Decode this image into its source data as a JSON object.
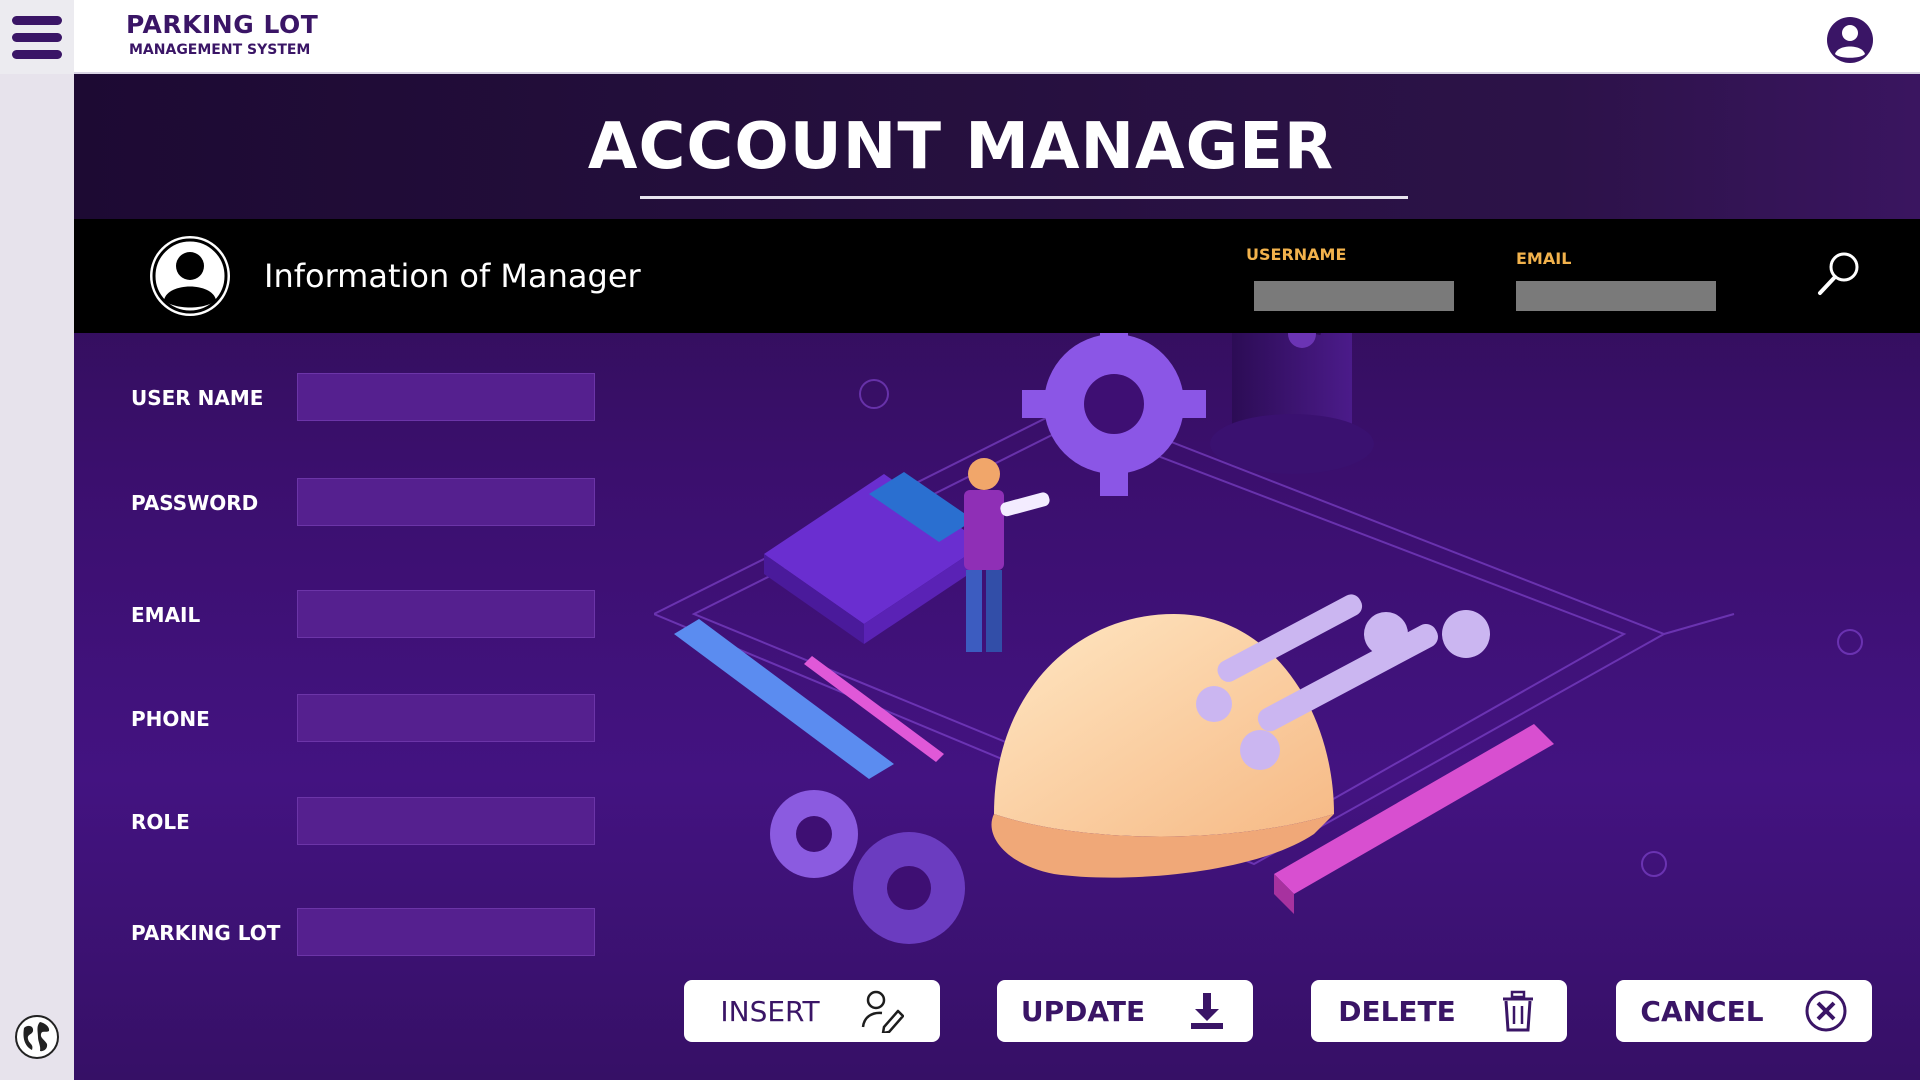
{
  "app": {
    "brand_title": "PARKING LOT",
    "brand_subtitle": "MANAGEMENT SYSTEM"
  },
  "page": {
    "title": "ACCOUNT MANAGER"
  },
  "info_bar": {
    "title": "Information of Manager",
    "username_filter_label": "USERNAME",
    "username_filter_value": "",
    "email_filter_label": "EMAIL",
    "email_filter_value": ""
  },
  "form": {
    "fields": [
      {
        "label": "USER NAME",
        "value": ""
      },
      {
        "label": "PASSWORD",
        "value": ""
      },
      {
        "label": "EMAIL",
        "value": ""
      },
      {
        "label": "PHONE",
        "value": ""
      },
      {
        "label": "ROLE",
        "value": ""
      },
      {
        "label": "PARKING LOT",
        "value": ""
      }
    ]
  },
  "actions": {
    "insert": "INSERT",
    "update": "UPDATE",
    "delete": "DELETE",
    "cancel": "CANCEL"
  },
  "icons": {
    "menu": "hamburger-menu-icon",
    "profile": "user-circle-icon",
    "globe": "globe-icon",
    "search": "magnifier-icon",
    "insert": "user-edit-icon",
    "update": "download-icon",
    "delete": "trash-icon",
    "cancel": "close-circle-icon"
  },
  "colors": {
    "brand": "#3a1566",
    "accent_label": "#f2b24c",
    "input_bg": "#55208f",
    "background": "#3b0f6e"
  }
}
